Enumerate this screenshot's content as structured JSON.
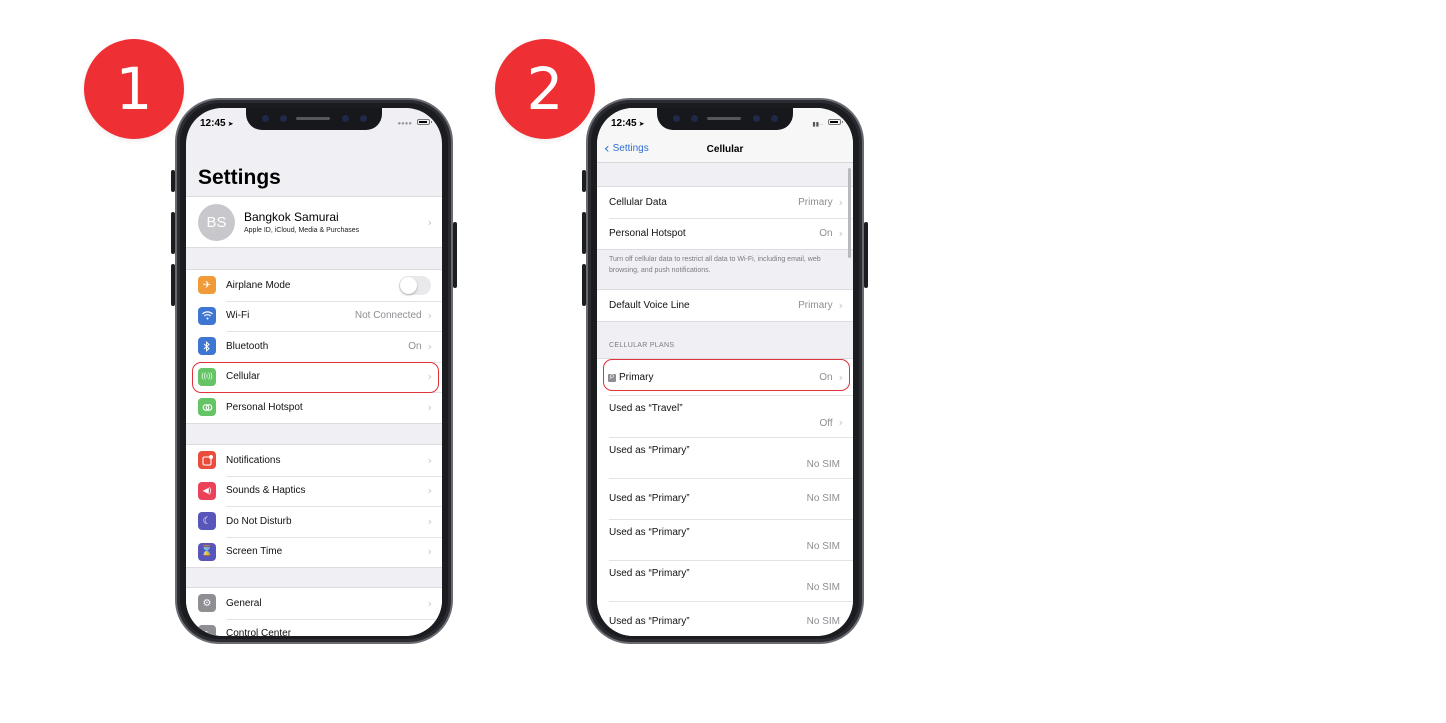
{
  "steps": [
    {
      "number": "1"
    },
    {
      "number": "2"
    }
  ],
  "colors": {
    "badge": "#ee2f34",
    "highlight": "#e2323b",
    "link": "#2f6fd6"
  },
  "phone1": {
    "status": {
      "time": "12:45",
      "location_icon": "location-arrow-icon"
    },
    "title": "Settings",
    "profile": {
      "initials": "BS",
      "name": "Bangkok Samurai",
      "subtitle": "Apple ID, iCloud, Media & Purchases"
    },
    "group1": [
      {
        "label": "Airplane Mode",
        "icon": "airplane-icon",
        "color": "#f19a38",
        "toggle": false
      },
      {
        "label": "Wi-Fi",
        "icon": "wifi-icon",
        "color": "#3f76d2",
        "value": "Not Connected"
      },
      {
        "label": "Bluetooth",
        "icon": "bluetooth-icon",
        "color": "#3f76d2",
        "value": "On"
      },
      {
        "label": "Cellular",
        "icon": "cellular-icon",
        "color": "#65c466",
        "value": "",
        "highlighted": true
      },
      {
        "label": "Personal Hotspot",
        "icon": "hotspot-icon",
        "color": "#65c466",
        "value": ""
      }
    ],
    "group2": [
      {
        "label": "Notifications",
        "icon": "notifications-icon",
        "color": "#eb4d3d"
      },
      {
        "label": "Sounds & Haptics",
        "icon": "sounds-icon",
        "color": "#eb4259"
      },
      {
        "label": "Do Not Disturb",
        "icon": "moon-icon",
        "color": "#5856b8"
      },
      {
        "label": "Screen Time",
        "icon": "hourglass-icon",
        "color": "#5856b8"
      }
    ],
    "group3": [
      {
        "label": "General",
        "icon": "gear-icon",
        "color": "#8e8e93"
      },
      {
        "label": "Control Center",
        "icon": "control-center-icon",
        "color": "#8e8e93"
      }
    ]
  },
  "phone2": {
    "status": {
      "time": "12:45"
    },
    "nav": {
      "back_label": "Settings",
      "title": "Cellular"
    },
    "group1": [
      {
        "label": "Cellular Data",
        "value": "Primary"
      },
      {
        "label": "Personal Hotspot",
        "value": "On"
      }
    ],
    "footer_note": "Turn off cellular data to restrict all data to Wi-Fi, including email, web browsing, and push notifications.",
    "voice": {
      "label": "Default Voice Line",
      "value": "Primary"
    },
    "plans_header": "CELLULAR PLANS",
    "plans": [
      {
        "badge": "P",
        "label": "Primary",
        "value": "On",
        "highlighted": true
      },
      {
        "label": "Used as “Travel”",
        "value": "Off"
      },
      {
        "label": "Used as “Primary”",
        "value": "No SIM"
      },
      {
        "label": "Used as “Primary”",
        "value": "No SIM"
      },
      {
        "label": "Used as “Primary”",
        "value": "No SIM"
      },
      {
        "label": "Used as “Primary”",
        "value": "No SIM"
      },
      {
        "label": "Used as “Primary”",
        "value": "No SIM"
      }
    ]
  }
}
